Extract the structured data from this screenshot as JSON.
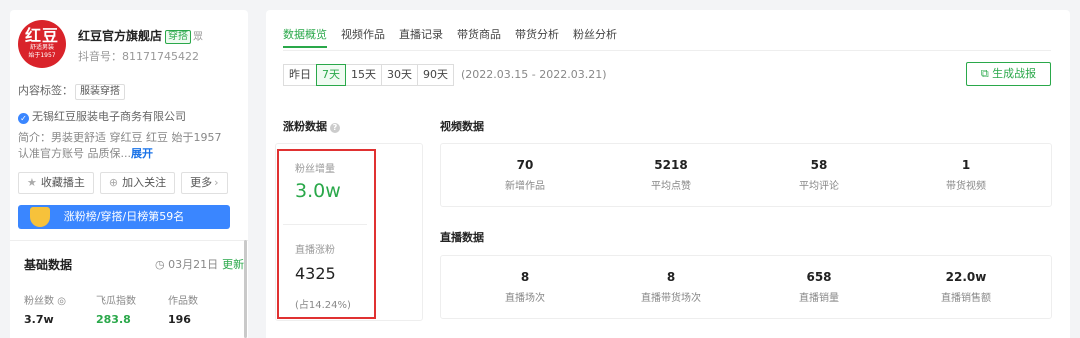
{
  "profile": {
    "logo_text": "红豆",
    "logo_sub": "舒适男装",
    "logo_sub2": "始于1957",
    "name": "红豆官方旗舰店",
    "tag": "穿搭",
    "tag2": "眾",
    "douyin_id": "抖音号：81171745422",
    "content_tag_label": "内容标签：",
    "content_tag": "服装穿搭",
    "company": "无锡红豆服装电子商务有限公司",
    "intro": "简介：男装更舒适 穿红豆 红豆 始于1957 认准官方账号 品质保...",
    "intro_more": "展开",
    "buttons": [
      "收藏播主",
      "加入关注",
      "更多"
    ],
    "rank_text": "涨粉榜/穿搭/日榜第59名"
  },
  "basic": {
    "title": "基础数据",
    "date": "03月21日",
    "update": "更新",
    "stats": [
      {
        "label": "粉丝数",
        "value": "3.7w"
      },
      {
        "label": "飞瓜指数",
        "value": "283.8"
      },
      {
        "label": "作品数",
        "value": "196"
      }
    ]
  },
  "tabs": [
    "数据概览",
    "视频作品",
    "直播记录",
    "带货商品",
    "带货分析",
    "粉丝分析"
  ],
  "active_tab": "数据概览",
  "ranges": [
    "昨日",
    "7天",
    "15天",
    "30天",
    "90天"
  ],
  "active_range": "7天",
  "date_range": "(2022.03.15 - 2022.03.21)",
  "generate_button": "生成战报",
  "fans": {
    "title": "涨粉数据",
    "growth_label": "粉丝增量",
    "growth_value": "3.0w",
    "live_label": "直播涨粉",
    "live_value": "4325",
    "live_note": "(占14.24%)"
  },
  "video": {
    "title": "视频数据",
    "metrics": [
      {
        "value": "70",
        "label": "新增作品"
      },
      {
        "value": "5218",
        "label": "平均点赞"
      },
      {
        "value": "58",
        "label": "平均评论"
      },
      {
        "value": "1",
        "label": "带货视频"
      }
    ]
  },
  "live": {
    "title": "直播数据",
    "metrics": [
      {
        "value": "8",
        "label": "直播场次"
      },
      {
        "value": "8",
        "label": "直播带货场次"
      },
      {
        "value": "658",
        "label": "直播销量"
      },
      {
        "value": "22.0w",
        "label": "直播销售额"
      }
    ]
  },
  "colors": {
    "accent": "#2aa84a",
    "brand": "#d9232a",
    "highlight": "#e03131",
    "link": "#1a73e8"
  }
}
